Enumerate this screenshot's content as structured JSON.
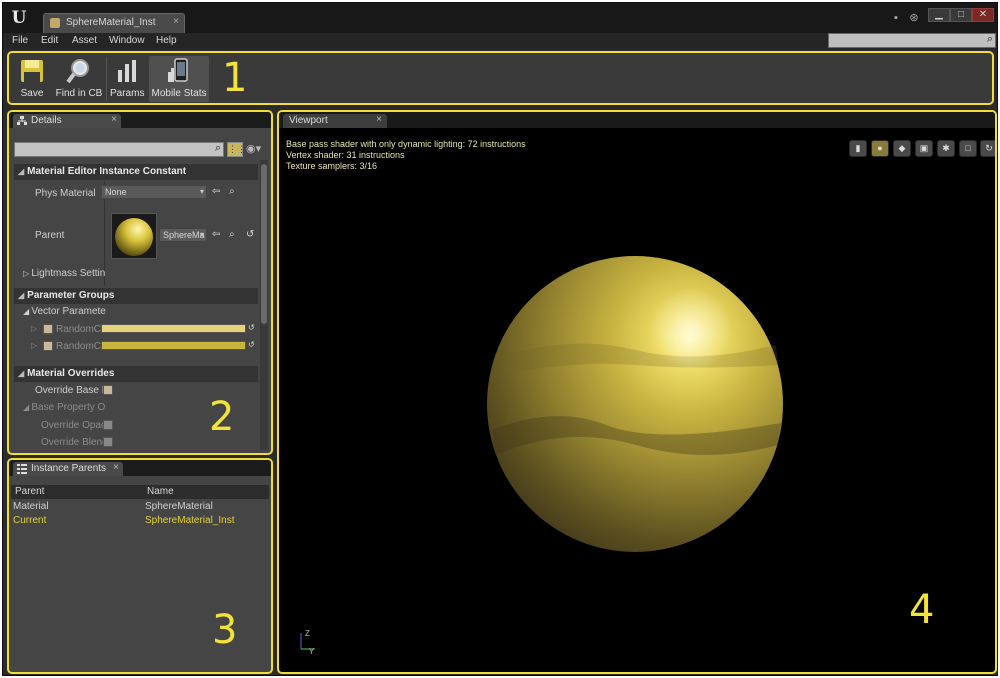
{
  "window": {
    "tab_title": "SphereMaterial_Inst"
  },
  "menu": {
    "items": [
      "File",
      "Edit",
      "Asset",
      "Window",
      "Help"
    ]
  },
  "toolbar": {
    "buttons": [
      {
        "label": "Save",
        "icon": "save-icon"
      },
      {
        "label": "Find in CB",
        "icon": "find-in-cb-icon"
      },
      {
        "label": "Params",
        "icon": "params-icon"
      },
      {
        "label": "Mobile Stats",
        "icon": "mobile-stats-icon"
      }
    ]
  },
  "region_labels": {
    "one": "1",
    "two": "2",
    "three": "3",
    "four": "4"
  },
  "details": {
    "tab_label": "Details",
    "section_instance": "Material Editor Instance Constant",
    "phys_material_label": "Phys Material",
    "phys_material_value": "None",
    "parent_label": "Parent",
    "parent_value": "SphereMa",
    "lightmass_label": "Lightmass Settin",
    "section_params": "Parameter Groups",
    "vector_params_label": "Vector Paramete",
    "random_color_1": "RandomCo",
    "random_color_2": "RandomCo",
    "section_overrides": "Material Overrides",
    "override_base_label": "Override Base Pr",
    "base_property_label": "Base Property O",
    "override_opacity_label": "Override Opaci",
    "override_blend_label": "Override Blend",
    "colors": {
      "random_color_1": "#e6d27a",
      "random_color_2": "#c9b43e"
    }
  },
  "instance_parents": {
    "tab_label": "Instance Parents",
    "columns": [
      "Parent",
      "Name"
    ],
    "rows": [
      {
        "parent": "Material",
        "name": "SphereMaterial",
        "color": "#d0d0d0"
      },
      {
        "parent": "Current",
        "name": "SphereMaterial_Inst",
        "color": "#e3d23a"
      }
    ]
  },
  "viewport": {
    "tab_label": "Viewport",
    "stats": [
      "Base pass shader with only dynamic lighting: 72 instructions",
      "Vertex shader: 31 instructions",
      "Texture samplers: 3/16"
    ],
    "axis_z": "Z",
    "axis_y": "Y"
  },
  "accent_color": "#f0dc3a"
}
